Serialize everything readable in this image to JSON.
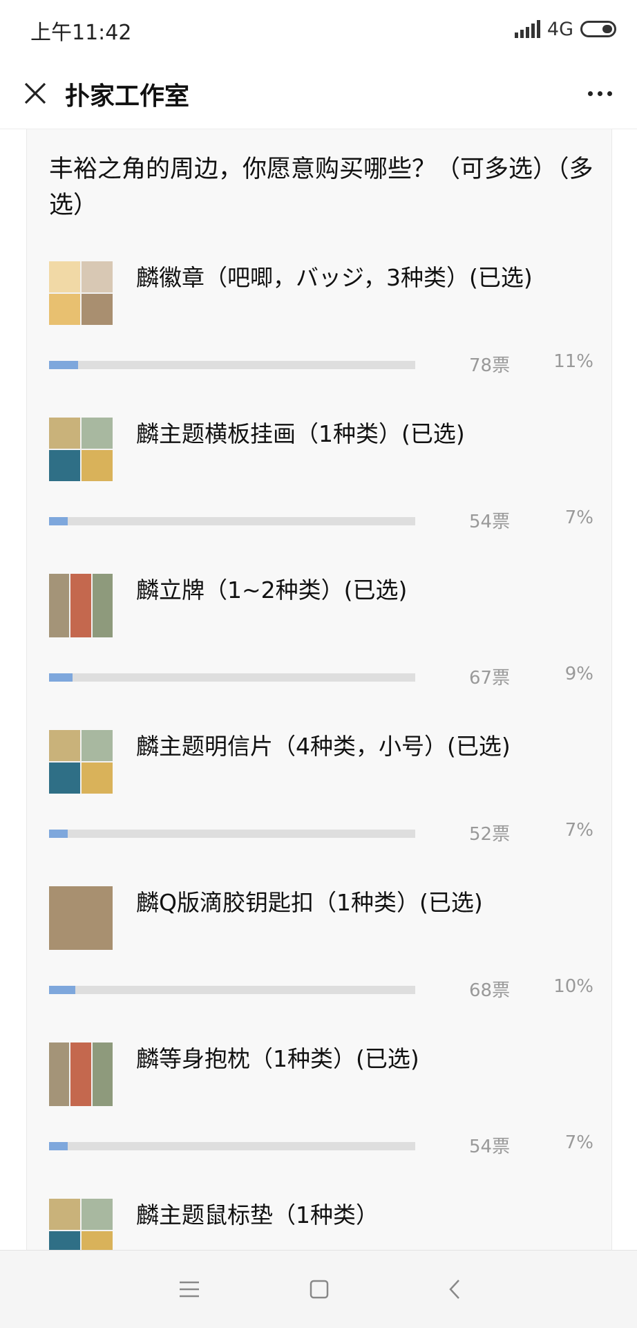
{
  "status_bar": {
    "time": "上午11:42",
    "network": "4G"
  },
  "header": {
    "title": "扑家工作室"
  },
  "poll": {
    "question": "丰裕之角的周边，你愿意购买哪些？（可多选）（多选）",
    "options": [
      {
        "label": "麟徽章（吧唧，バッジ，3种类）(已选)",
        "votes": "78票",
        "percent": "11%",
        "fill": 0.11
      },
      {
        "label": "麟主题横板挂画（1种类）(已选)",
        "votes": "54票",
        "percent": "7%",
        "fill": 0.07
      },
      {
        "label": "麟立牌（1~2种类）(已选)",
        "votes": "67票",
        "percent": "9%",
        "fill": 0.09
      },
      {
        "label": "麟主题明信片（4种类，小号）(已选)",
        "votes": "52票",
        "percent": "7%",
        "fill": 0.07
      },
      {
        "label": "麟Q版滴胶钥匙扣（1种类）(已选)",
        "votes": "68票",
        "percent": "10%",
        "fill": 0.1
      },
      {
        "label": "麟等身抱枕（1种类）(已选)",
        "votes": "54票",
        "percent": "7%",
        "fill": 0.07
      },
      {
        "label": "麟主题鼠标垫（1种类）",
        "votes": "",
        "percent": "",
        "fill": null
      }
    ]
  },
  "colors": {
    "bar_fill": "#7ea7dc",
    "bar_track": "#dedede",
    "card_bg": "#f8f8f8"
  }
}
